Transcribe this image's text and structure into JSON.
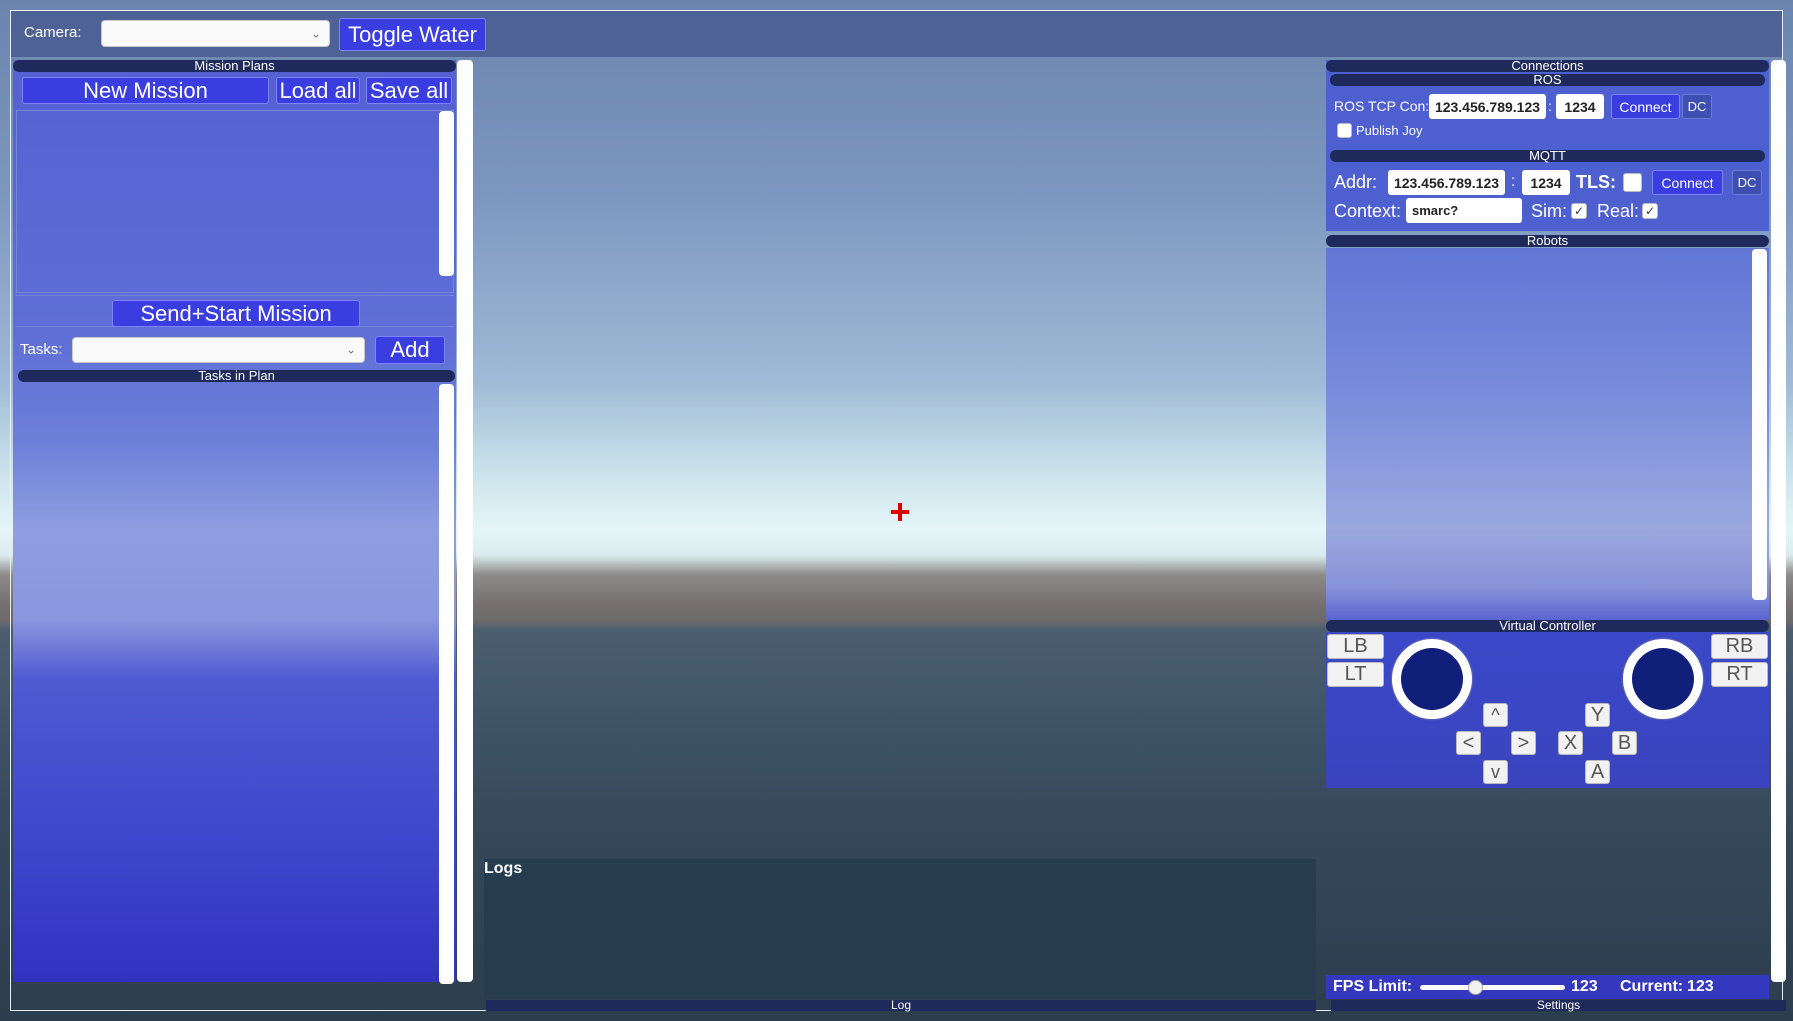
{
  "topbar": {
    "camera_label": "Camera:",
    "camera_value": "",
    "toggle_water": "Toggle Water"
  },
  "mission_plans": {
    "header": "Mission Plans",
    "new_mission": "New Mission",
    "load_all": "Load all",
    "save_all": "Save all",
    "send_start": "Send+Start Mission",
    "tasks_label": "Tasks:",
    "tasks_value": "",
    "add": "Add",
    "tasks_in_plan": "Tasks in Plan"
  },
  "connections": {
    "header": "Connections",
    "ros": {
      "header": "ROS",
      "tcp_label": "ROS TCP Con:",
      "ip": "123.456.789.123",
      "sep": ":",
      "port": "1234",
      "connect": "Connect",
      "dc": "DC",
      "publish_joy": "Publish Joy",
      "publish_joy_checked": false
    },
    "mqtt": {
      "header": "MQTT",
      "addr_label": "Addr:",
      "ip": "123.456.789.123",
      "sep": ":",
      "port": "1234",
      "tls_label": "TLS:",
      "tls_checked": false,
      "connect": "Connect",
      "dc": "DC",
      "context_label": "Context:",
      "context_value": "smarc?",
      "sim_label": "Sim:",
      "sim_checked": true,
      "real_label": "Real:",
      "real_checked": true
    }
  },
  "robots": {
    "header": "Robots"
  },
  "virtual_controller": {
    "header": "Virtual Controller",
    "lb": "LB",
    "lt": "LT",
    "rb": "RB",
    "rt": "RT",
    "up": "^",
    "left": "<",
    "right": ">",
    "down": "v",
    "y": "Y",
    "x": "X",
    "b": "B",
    "a": "A"
  },
  "logs": {
    "title": "Logs",
    "footer": "Log"
  },
  "fps": {
    "limit_label": "FPS Limit:",
    "limit_value": "123",
    "slider_fraction": 0.38,
    "current_label": "Current:",
    "current_value": "123"
  },
  "settings": {
    "label": "Settings"
  },
  "colors": {
    "accent_button": "#3a3ddf",
    "header_bar": "#1e2a5c",
    "crosshair": "#e00000"
  }
}
